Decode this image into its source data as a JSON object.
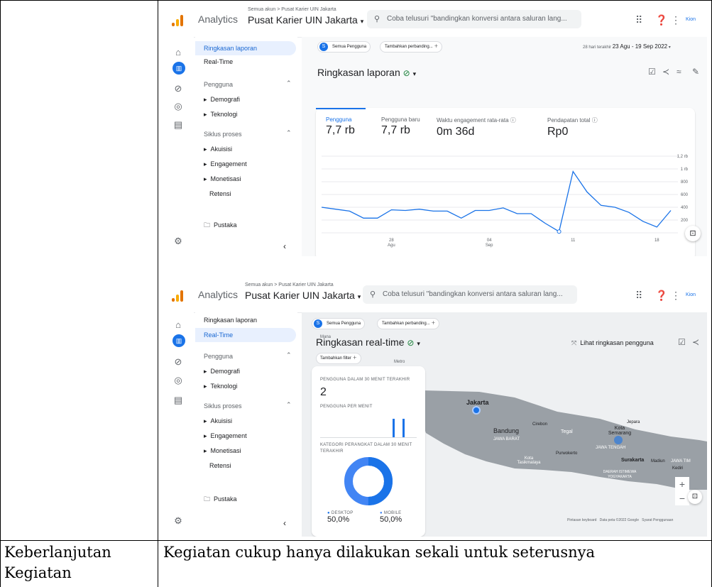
{
  "shared": {
    "app_title": "Analytics",
    "breadcrumb": "Semua akun > Pusat Karier UIN Jakarta",
    "property": "Pusat Karier UIN Jakarta",
    "search_placeholder": "Coba telusuri \"bandingkan konversi antara saluran lang...",
    "user_label": "Kion"
  },
  "nav": {
    "ringkasan": "Ringkasan laporan",
    "realtime": "Real-Time",
    "pengguna": "Pengguna",
    "demografi": "Demografi",
    "teknologi": "Teknologi",
    "siklus": "Siklus proses",
    "akuisisi": "Akuisisi",
    "engagement": "Engagement",
    "monetisasi": "Monetisasi",
    "retensi": "Retensi",
    "pustaka": "Pustaka"
  },
  "report": {
    "chip_all": "Semua Pengguna",
    "chip_compare": "Tambahkan perbanding...",
    "date_prefix": "28 hari terakhir",
    "date_range": "23 Agu - 19 Sep 2022",
    "title": "Ringkasan laporan",
    "metrics": [
      {
        "label": "Pengguna",
        "value": "7,7 rb"
      },
      {
        "label": "Pengguna baru",
        "value": "7,7 rb"
      },
      {
        "label": "Waktu engagement rata-rata",
        "value": "0m 36d"
      },
      {
        "label": "Pendapatan total",
        "value": "Rp0"
      }
    ]
  },
  "chart_data": {
    "type": "line",
    "x_ticks": [
      "28 Agu",
      "04 Sep",
      "11",
      "18"
    ],
    "y_ticks": [
      "1,2 rb",
      "1 rb",
      "800",
      "600",
      "400",
      "200",
      "0"
    ],
    "ylim": [
      0,
      1200
    ],
    "values": [
      400,
      370,
      340,
      230,
      230,
      360,
      350,
      370,
      340,
      340,
      230,
      350,
      350,
      390,
      300,
      300,
      150,
      20,
      960,
      640,
      430,
      400,
      320,
      180,
      90,
      350
    ]
  },
  "realtime": {
    "chip_all": "Semua Pengguna",
    "chip_compare": "Tambahkan perbanding...",
    "title": "Ringkasan real-time",
    "add_filter": "Tambahkan filter",
    "view_user": "Lihat ringkasan pengguna",
    "users_30_label": "PENGGUNA DALAM 30 MENIT TERAKHIR",
    "users_30_value": "2",
    "users_per_min": "PENGGUNA PER MENIT",
    "device_label": "KATEGORI PERANGKAT DALAM 30 MENIT TERAKHIR",
    "desktop_label": "DESKTOP",
    "desktop_value": "50,0%",
    "mobile_label": "MOBILE",
    "mobile_value": "50,0%",
    "map_labels": {
      "jakarta": "Jakarta",
      "bandung": "Bandung",
      "jawa_barat": "JAWA BARAT",
      "cirebon": "Cirebon",
      "tegal": "Tegal",
      "kota_semarang": "Kota Semarang",
      "jepara": "Jepara",
      "jawa_tengah": "JAWA TENGAH",
      "purwokerto": "Purwokerto",
      "kota_tasik": "Kota Tasikmalaya",
      "surakarta": "Surakarta",
      "madiun": "Madiun",
      "jawa_timur": "JAWA TIM",
      "kediri": "Kediri",
      "diy": "DAERAH ISTIMEWA YOGYAKARTA",
      "metro": "Metro",
      "mana": "Mana"
    },
    "footer": "Pintasan keyboard   Data peta ©2022 Google   Syarat Penggunaan"
  },
  "table": {
    "left_label_1": "Keberlanjutan",
    "left_label_2": "Kegiatan",
    "right_text": "Kegiatan cukup hanya dilakukan sekali untuk seterusnya"
  }
}
